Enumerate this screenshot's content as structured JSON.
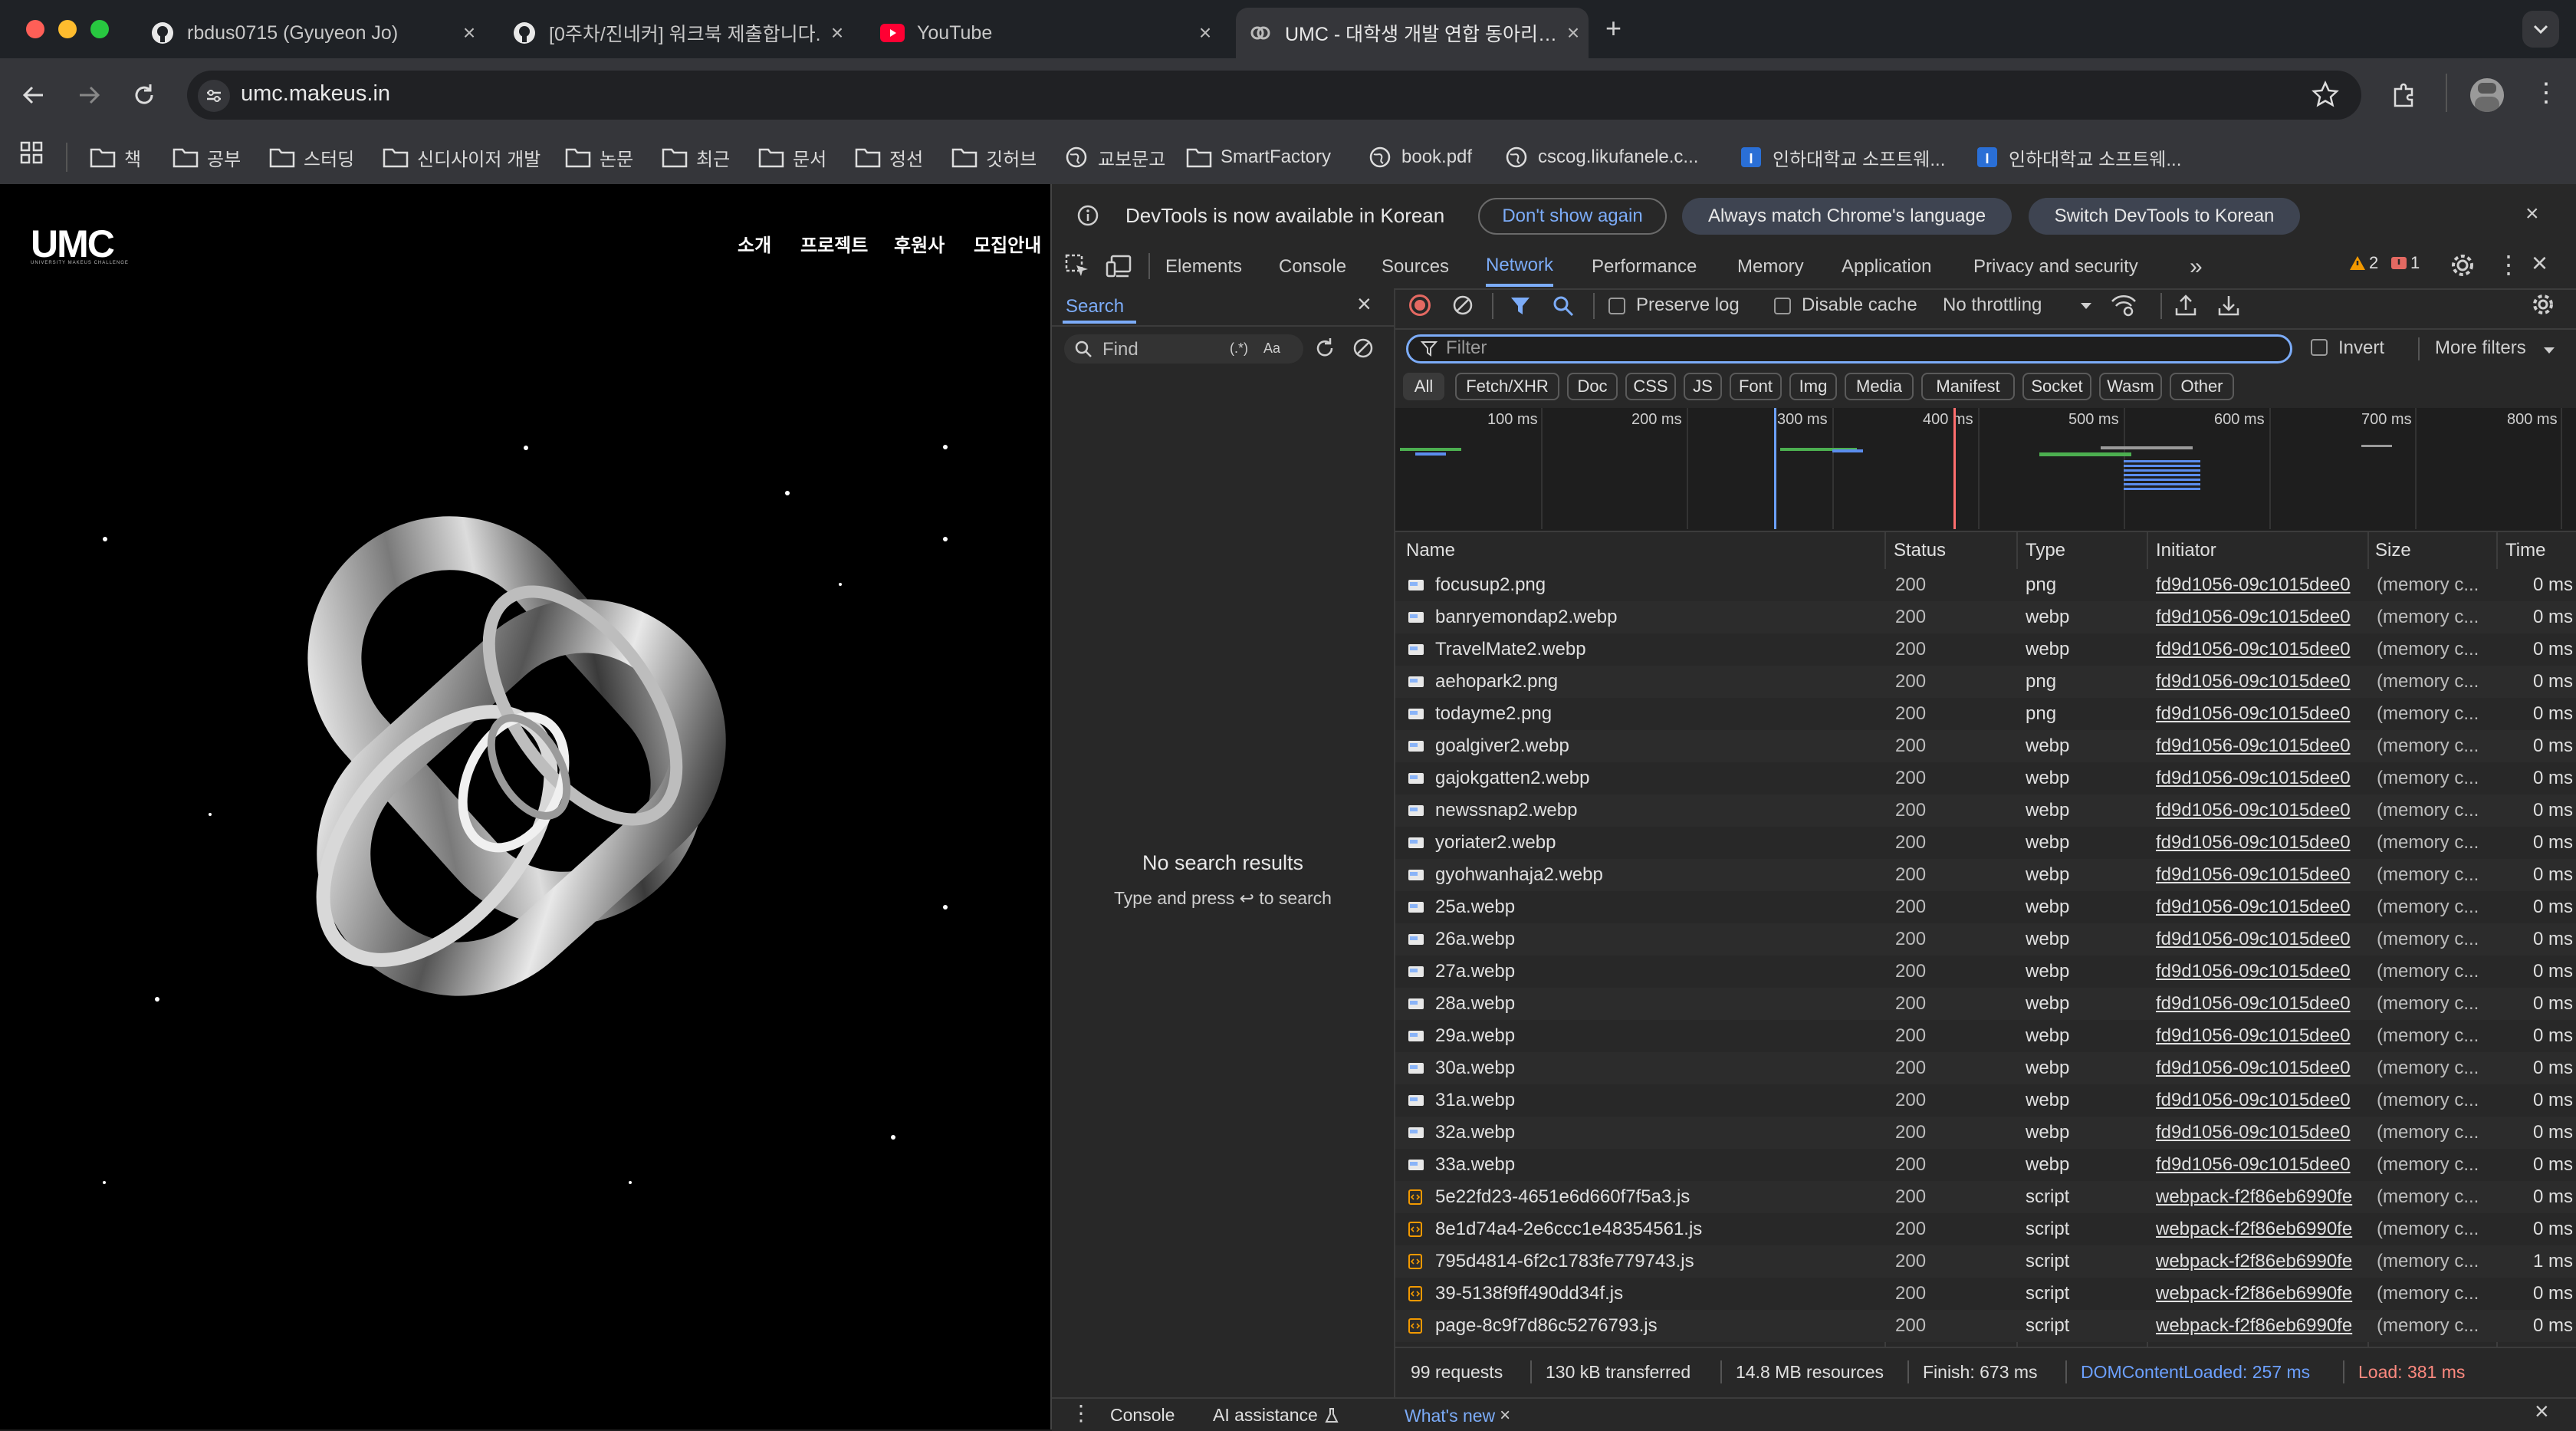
{
  "tabs": [
    {
      "title": "rbdus0715 (Gyuyeon Jo)",
      "icon": "github-icon"
    },
    {
      "title": "[0주차/진네커] 워크북 제출합니다.",
      "icon": "github-icon"
    },
    {
      "title": "YouTube",
      "icon": "youtube-icon"
    },
    {
      "title": "UMC - 대학생 개발 연합 동아리 UMC",
      "icon": "umc-favicon-icon"
    }
  ],
  "address": {
    "url": "umc.makeus.in"
  },
  "bookmarks": [
    {
      "label": "책",
      "icon": "folder-icon"
    },
    {
      "label": "공부",
      "icon": "folder-icon"
    },
    {
      "label": "스터딩",
      "icon": "folder-icon"
    },
    {
      "label": "신디사이저 개발",
      "icon": "folder-icon"
    },
    {
      "label": "논문",
      "icon": "folder-icon"
    },
    {
      "label": "최근",
      "icon": "folder-icon"
    },
    {
      "label": "문서",
      "icon": "folder-icon"
    },
    {
      "label": "정선",
      "icon": "folder-icon"
    },
    {
      "label": "깃허브",
      "icon": "folder-icon"
    },
    {
      "label": "교보문고",
      "icon": "globe-icon"
    },
    {
      "label": "SmartFactory",
      "icon": "folder-icon"
    },
    {
      "label": "book.pdf",
      "icon": "globe-icon"
    },
    {
      "label": "cscog.likufanele.c...",
      "icon": "globe-icon"
    },
    {
      "label": "인하대학교 소프트웨...",
      "icon": "inha-icon"
    },
    {
      "label": "인하대학교 소프트웨...",
      "icon": "inha-icon"
    }
  ],
  "site": {
    "logo": "UMC",
    "logo_sub": "UNIVERSITY MAKEUS CHALLENGE",
    "nav": [
      "소개",
      "프로젝트",
      "후원사",
      "모집안내"
    ]
  },
  "devtools": {
    "infobar": {
      "message": "DevTools is now available in Korean",
      "btn_dont_show": "Don't show again",
      "btn_match": "Always match Chrome's language",
      "btn_switch": "Switch DevTools to Korean"
    },
    "tabs": [
      "Elements",
      "Console",
      "Sources",
      "Network",
      "Performance",
      "Memory",
      "Application",
      "Privacy and security"
    ],
    "active_tab": "Network",
    "warnings": "2",
    "errors": "1",
    "search": {
      "title": "Search",
      "placeholder": "Find",
      "regex": "(.*)",
      "case": "Aa",
      "empty_title": "No search results",
      "empty_hint": "Type and press ↩ to search"
    },
    "network": {
      "preserve_log": "Preserve log",
      "disable_cache": "Disable cache",
      "throttling": "No throttling",
      "filter_placeholder": "Filter",
      "invert": "Invert",
      "more_filters": "More filters",
      "type_filters": [
        "All",
        "Fetch/XHR",
        "Doc",
        "CSS",
        "JS",
        "Font",
        "Img",
        "Media",
        "Manifest",
        "Socket",
        "Wasm",
        "Other"
      ],
      "timeline_ticks": [
        "100 ms",
        "200 ms",
        "300 ms",
        "400 ms",
        "500 ms",
        "600 ms",
        "700 ms",
        "800 ms"
      ],
      "columns": [
        "Name",
        "Status",
        "Type",
        "Initiator",
        "Size",
        "Time"
      ],
      "rows": [
        {
          "name": "focusup2.png",
          "status": "200",
          "type": "png",
          "initiator": "fd9d1056-09c1015dee0",
          "size": "(memory c...",
          "time": "0 ms",
          "icon": "image-icon"
        },
        {
          "name": "banryemondap2.webp",
          "status": "200",
          "type": "webp",
          "initiator": "fd9d1056-09c1015dee0",
          "size": "(memory c...",
          "time": "0 ms",
          "icon": "image-icon"
        },
        {
          "name": "TravelMate2.webp",
          "status": "200",
          "type": "webp",
          "initiator": "fd9d1056-09c1015dee0",
          "size": "(memory c...",
          "time": "0 ms",
          "icon": "image-icon"
        },
        {
          "name": "aehopark2.png",
          "status": "200",
          "type": "png",
          "initiator": "fd9d1056-09c1015dee0",
          "size": "(memory c...",
          "time": "0 ms",
          "icon": "image-icon"
        },
        {
          "name": "todayme2.png",
          "status": "200",
          "type": "png",
          "initiator": "fd9d1056-09c1015dee0",
          "size": "(memory c...",
          "time": "0 ms",
          "icon": "image-icon"
        },
        {
          "name": "goalgiver2.webp",
          "status": "200",
          "type": "webp",
          "initiator": "fd9d1056-09c1015dee0",
          "size": "(memory c...",
          "time": "0 ms",
          "icon": "image-icon"
        },
        {
          "name": "gajokgatten2.webp",
          "status": "200",
          "type": "webp",
          "initiator": "fd9d1056-09c1015dee0",
          "size": "(memory c...",
          "time": "0 ms",
          "icon": "image-icon"
        },
        {
          "name": "newssnap2.webp",
          "status": "200",
          "type": "webp",
          "initiator": "fd9d1056-09c1015dee0",
          "size": "(memory c...",
          "time": "0 ms",
          "icon": "image-icon"
        },
        {
          "name": "yoriater2.webp",
          "status": "200",
          "type": "webp",
          "initiator": "fd9d1056-09c1015dee0",
          "size": "(memory c...",
          "time": "0 ms",
          "icon": "image-icon"
        },
        {
          "name": "gyohwanhaja2.webp",
          "status": "200",
          "type": "webp",
          "initiator": "fd9d1056-09c1015dee0",
          "size": "(memory c...",
          "time": "0 ms",
          "icon": "image-icon"
        },
        {
          "name": "25a.webp",
          "status": "200",
          "type": "webp",
          "initiator": "fd9d1056-09c1015dee0",
          "size": "(memory c...",
          "time": "0 ms",
          "icon": "image-icon"
        },
        {
          "name": "26a.webp",
          "status": "200",
          "type": "webp",
          "initiator": "fd9d1056-09c1015dee0",
          "size": "(memory c...",
          "time": "0 ms",
          "icon": "image-icon"
        },
        {
          "name": "27a.webp",
          "status": "200",
          "type": "webp",
          "initiator": "fd9d1056-09c1015dee0",
          "size": "(memory c...",
          "time": "0 ms",
          "icon": "image-icon"
        },
        {
          "name": "28a.webp",
          "status": "200",
          "type": "webp",
          "initiator": "fd9d1056-09c1015dee0",
          "size": "(memory c...",
          "time": "0 ms",
          "icon": "image-icon"
        },
        {
          "name": "29a.webp",
          "status": "200",
          "type": "webp",
          "initiator": "fd9d1056-09c1015dee0",
          "size": "(memory c...",
          "time": "0 ms",
          "icon": "image-icon"
        },
        {
          "name": "30a.webp",
          "status": "200",
          "type": "webp",
          "initiator": "fd9d1056-09c1015dee0",
          "size": "(memory c...",
          "time": "0 ms",
          "icon": "image-icon"
        },
        {
          "name": "31a.webp",
          "status": "200",
          "type": "webp",
          "initiator": "fd9d1056-09c1015dee0",
          "size": "(memory c...",
          "time": "0 ms",
          "icon": "image-icon"
        },
        {
          "name": "32a.webp",
          "status": "200",
          "type": "webp",
          "initiator": "fd9d1056-09c1015dee0",
          "size": "(memory c...",
          "time": "0 ms",
          "icon": "image-icon"
        },
        {
          "name": "33a.webp",
          "status": "200",
          "type": "webp",
          "initiator": "fd9d1056-09c1015dee0",
          "size": "(memory c...",
          "time": "0 ms",
          "icon": "image-icon"
        },
        {
          "name": "5e22fd23-4651e6d660f7f5a3.js",
          "status": "200",
          "type": "script",
          "initiator": "webpack-f2f86eb6990fe",
          "size": "(memory c...",
          "time": "0 ms",
          "icon": "script-icon"
        },
        {
          "name": "8e1d74a4-2e6ccc1e48354561.js",
          "status": "200",
          "type": "script",
          "initiator": "webpack-f2f86eb6990fe",
          "size": "(memory c...",
          "time": "0 ms",
          "icon": "script-icon"
        },
        {
          "name": "795d4814-6f2c1783fe779743.js",
          "status": "200",
          "type": "script",
          "initiator": "webpack-f2f86eb6990fe",
          "size": "(memory c...",
          "time": "1 ms",
          "icon": "script-icon"
        },
        {
          "name": "39-5138f9ff490dd34f.js",
          "status": "200",
          "type": "script",
          "initiator": "webpack-f2f86eb6990fe",
          "size": "(memory c...",
          "time": "0 ms",
          "icon": "script-icon"
        },
        {
          "name": "page-8c9f7d86c5276793.js",
          "status": "200",
          "type": "script",
          "initiator": "webpack-f2f86eb6990fe",
          "size": "(memory c...",
          "time": "0 ms",
          "icon": "script-icon"
        }
      ],
      "summary": {
        "requests": "99 requests",
        "transferred": "130 kB transferred",
        "resources": "14.8 MB resources",
        "finish": "Finish: 673 ms",
        "dom_loaded": "DOMContentLoaded: 257 ms",
        "load": "Load: 381 ms"
      }
    },
    "drawer": {
      "console": "Console",
      "ai": "AI assistance",
      "whats_new": "What's new"
    }
  },
  "colors": {
    "accent": "#7cacf8",
    "dom_loaded": "#6ca0ff",
    "load": "#ff6e6e",
    "record": "#e46962",
    "warning": "#f29900",
    "error": "#e46962"
  }
}
